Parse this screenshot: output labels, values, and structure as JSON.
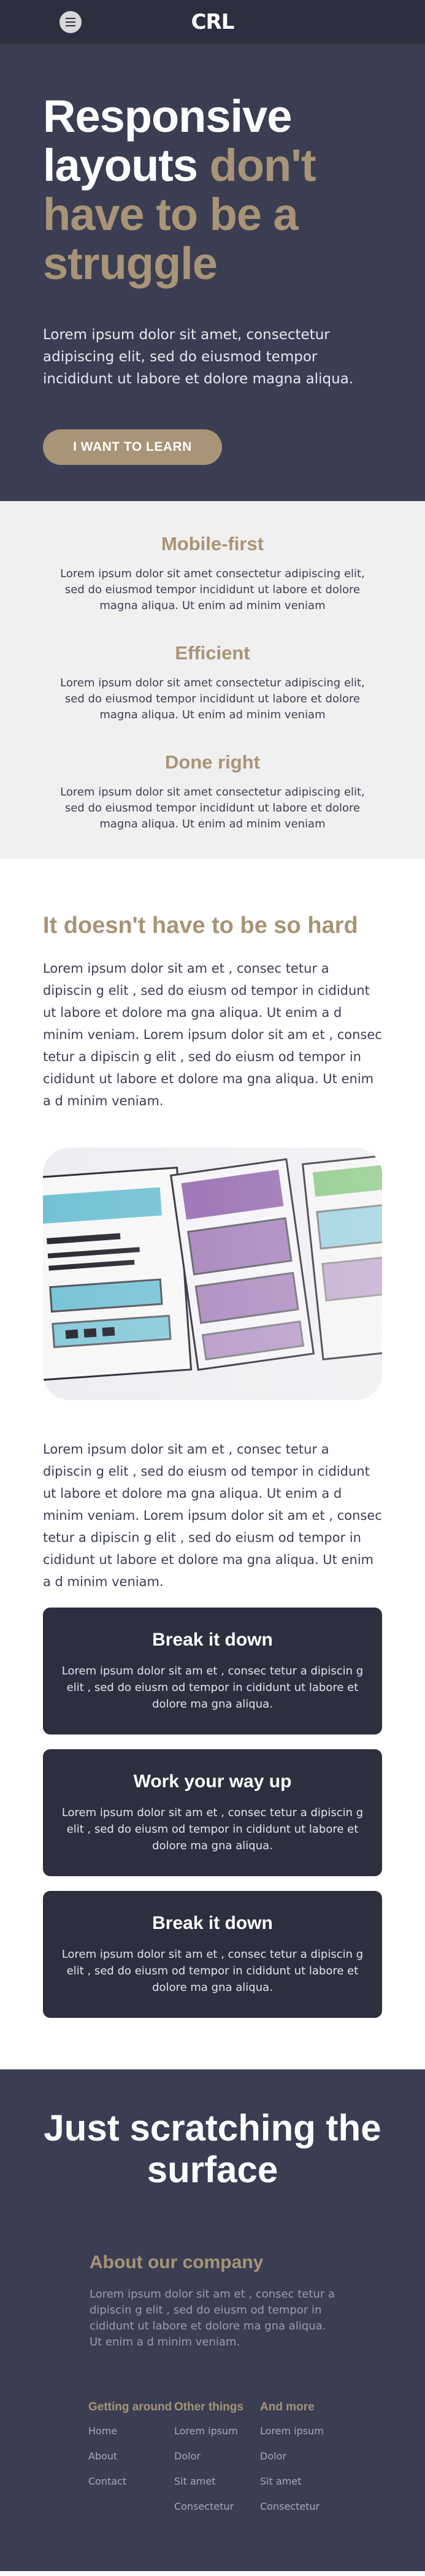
{
  "header": {
    "logo": "CRL"
  },
  "hero": {
    "title_part1": "Responsive layouts ",
    "title_accent": "don't have to be a struggle",
    "text": "Lorem ipsum dolor sit amet, consectetur adipiscing elit, sed do eiusmod tempor incididunt ut labore et dolore magna aliqua.",
    "cta": "I WANT TO LEARN"
  },
  "features": [
    {
      "title": "Mobile-first",
      "text": "Lorem ipsum dolor sit amet consectetur adipiscing elit, sed do eiusmod tempor incididunt ut labore et dolore magna aliqua. Ut enim ad minim veniam"
    },
    {
      "title": "Efficient",
      "text": "Lorem ipsum dolor sit amet consectetur adipiscing elit, sed do eiusmod tempor incididunt ut labore et dolore magna aliqua. Ut enim ad minim veniam"
    },
    {
      "title": "Done right",
      "text": "Lorem ipsum dolor sit amet consectetur adipiscing elit, sed do eiusmod tempor incididunt ut labore et dolore magna aliqua. Ut enim ad minim veniam"
    }
  ],
  "content": {
    "heading": "It doesn't have to be so hard",
    "para1": "Lorem ipsum dolor sit am et , consec tetur a dipiscin g elit , sed do eiusm od tempor in cididunt ut labore et dolore ma gna aliqua. Ut enim a d minim veniam. Lorem ipsum dolor sit am et , consec tetur a dipiscin g elit , sed do eiusm od tempor in cididunt ut labore et dolore ma gna aliqua. Ut enim a d minim veniam.",
    "para2": "Lorem ipsum dolor sit am et , consec tetur a dipiscin g elit , sed do eiusm od tempor in cididunt ut labore et dolore ma gna aliqua. Ut enim a d minim veniam. Lorem ipsum dolor sit am et , consec tetur a dipiscin g elit , sed do eiusm od tempor in cididunt ut labore et dolore ma gna aliqua. Ut enim a d minim veniam."
  },
  "cards": [
    {
      "title": "Break it down",
      "text": "Lorem ipsum dolor sit am et , consec tetur a dipiscin g elit , sed do eiusm od tempor in cididunt ut labore et dolore ma gna aliqua."
    },
    {
      "title": "Work your way up",
      "text": "Lorem ipsum dolor sit am et , consec tetur a dipiscin g elit , sed do eiusm od tempor in cididunt ut labore et dolore ma gna aliqua."
    },
    {
      "title": "Break it down",
      "text": "Lorem ipsum dolor sit am et , consec tetur a dipiscin g elit , sed do eiusm od tempor in cididunt ut labore et dolore ma gna aliqua."
    }
  ],
  "footer": {
    "heading": "Just scratching the surface",
    "about_title": "About our company",
    "about_text": "Lorem ipsum dolor sit am et , consec tetur a dipiscin g elit , sed do eiusm od tempor in cididunt ut labore et dolore ma gna aliqua. Ut enim a d minim veniam.",
    "columns": [
      {
        "title": "Getting around",
        "links": [
          "Home",
          "About",
          "Contact"
        ]
      },
      {
        "title": "Other things",
        "links": [
          "Lorem ipsum",
          "Dolor",
          "Sit amet",
          "Consectetur"
        ]
      },
      {
        "title": "And more",
        "links": [
          "Lorem ipsum",
          "Dolor",
          "Sit amet",
          "Consectetur"
        ]
      }
    ]
  },
  "colors": {
    "dark": "#2d2f3f",
    "hero": "#3b3e52",
    "accent": "#a89476",
    "light": "#f0f0f0"
  },
  "icons": {
    "menu": "hamburger-menu-icon"
  }
}
